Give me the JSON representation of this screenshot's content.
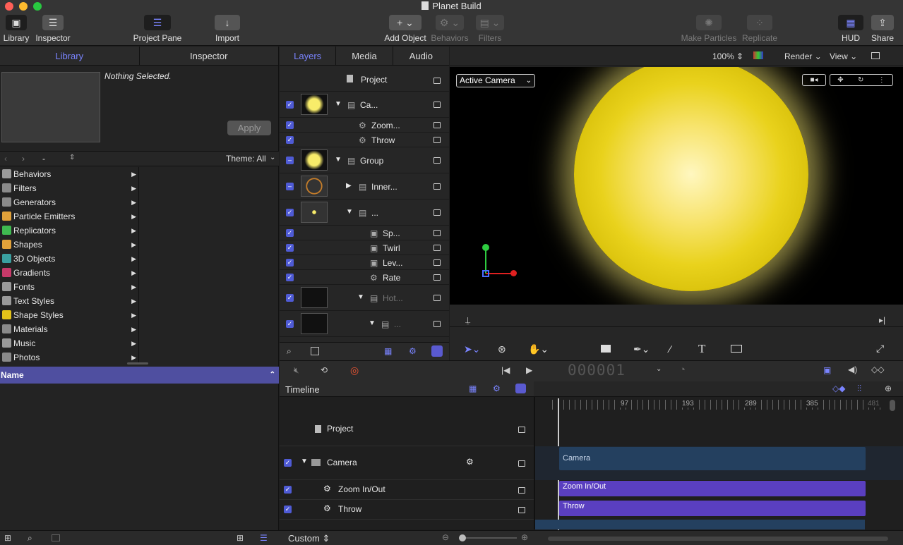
{
  "window": {
    "title": "Planet Build"
  },
  "toolbar": {
    "library": "Library",
    "inspector": "Inspector",
    "project_pane": "Project Pane",
    "import": "Import",
    "add_object": "Add Object",
    "behaviors": "Behaviors",
    "filters": "Filters",
    "make_particles": "Make Particles",
    "replicate": "Replicate",
    "hud": "HUD",
    "share": "Share"
  },
  "left": {
    "tabs": [
      "Library",
      "Inspector"
    ],
    "nothing_selected": "Nothing Selected.",
    "apply": "Apply",
    "path_value": "-",
    "theme": "Theme: All",
    "categories": [
      {
        "label": "Behaviors",
        "icon": "gear-icon",
        "color": "#9a9a9a"
      },
      {
        "label": "Filters",
        "icon": "film-icon",
        "color": "#8a8a8a"
      },
      {
        "label": "Generators",
        "icon": "generator-icon",
        "color": "#8a8a8a"
      },
      {
        "label": "Particle Emitters",
        "icon": "emitter-icon",
        "color": "#e2a23a"
      },
      {
        "label": "Replicators",
        "icon": "replicator-icon",
        "color": "#3fb950"
      },
      {
        "label": "Shapes",
        "icon": "shape-icon",
        "color": "#e2a23a"
      },
      {
        "label": "3D Objects",
        "icon": "cube-icon",
        "color": "#3aa0a0"
      },
      {
        "label": "Gradients",
        "icon": "gradient-icon",
        "color": "#c73a6a"
      },
      {
        "label": "Fonts",
        "icon": "font-icon",
        "color": "#9a9a9a"
      },
      {
        "label": "Text Styles",
        "icon": "text-style-icon",
        "color": "#9a9a9a"
      },
      {
        "label": "Shape Styles",
        "icon": "shape-style-icon",
        "color": "#e2c21a"
      },
      {
        "label": "Materials",
        "icon": "material-icon",
        "color": "#8a8a8a"
      },
      {
        "label": "Music",
        "icon": "music-icon",
        "color": "#9a9a9a"
      },
      {
        "label": "Photos",
        "icon": "photo-icon",
        "color": "#8a8a8a"
      }
    ],
    "name_header": "Name"
  },
  "layers": {
    "tabs": [
      "Layers",
      "Media",
      "Audio"
    ],
    "project": "Project",
    "rows": [
      {
        "name": "Ca...",
        "checked": true
      },
      {
        "name": "Zoom...",
        "checked": true
      },
      {
        "name": "Throw",
        "checked": true
      },
      {
        "name": "Group",
        "checked": "mixed"
      },
      {
        "name": "Inner...",
        "checked": "mixed"
      },
      {
        "name": "...",
        "checked": true
      },
      {
        "name": "Sp...",
        "checked": true
      },
      {
        "name": "Twirl",
        "checked": true
      },
      {
        "name": "Lev...",
        "checked": true
      },
      {
        "name": "Rate",
        "checked": true
      },
      {
        "name": "Hot...",
        "checked": true
      },
      {
        "name": "...",
        "checked": true
      }
    ]
  },
  "canvas": {
    "zoom": "100%",
    "render": "Render",
    "view": "View",
    "camera": "Active Camera"
  },
  "transport": {
    "timecode": "000001"
  },
  "timeline": {
    "label": "Timeline",
    "ruler": [
      "97",
      "193",
      "289",
      "385",
      "481"
    ],
    "rows": {
      "project": "Project",
      "camera": "Camera",
      "zoom": "Zoom In/Out",
      "throw": "Throw"
    },
    "bars": {
      "camera": "Camera",
      "zoom": "Zoom In/Out",
      "throw": "Throw"
    }
  },
  "bottom": {
    "custom": "Custom"
  }
}
